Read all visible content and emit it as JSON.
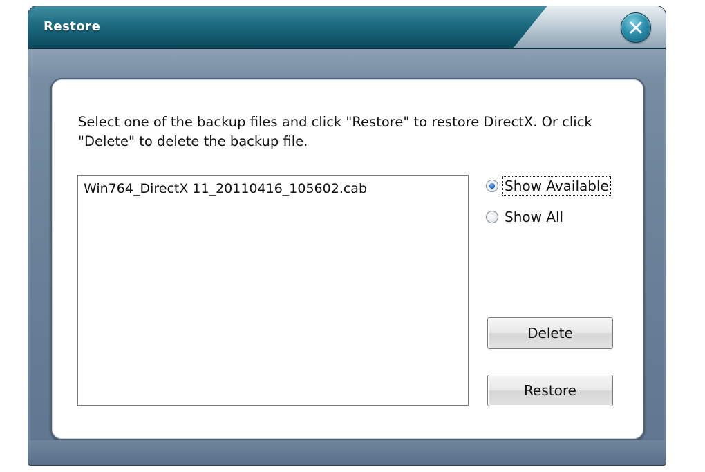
{
  "window": {
    "title": "Restore"
  },
  "instruction": "Select one of the backup files and click \"Restore\" to restore DirectX. Or click \"Delete\" to delete the backup file.",
  "backup_list": {
    "items": [
      {
        "label": "Win764_DirectX 11_20110416_105602.cab"
      }
    ]
  },
  "filter": {
    "options": [
      {
        "label": "Show Available",
        "selected": true,
        "focused": true
      },
      {
        "label": "Show All",
        "selected": false,
        "focused": false
      }
    ]
  },
  "buttons": {
    "delete_label": "Delete",
    "restore_label": "Restore"
  },
  "icons": {
    "close": "close-icon"
  },
  "colors": {
    "titlebar": "#1c6a7f",
    "frame": "#6e849b",
    "radio_dot": "#1b5fc7"
  }
}
